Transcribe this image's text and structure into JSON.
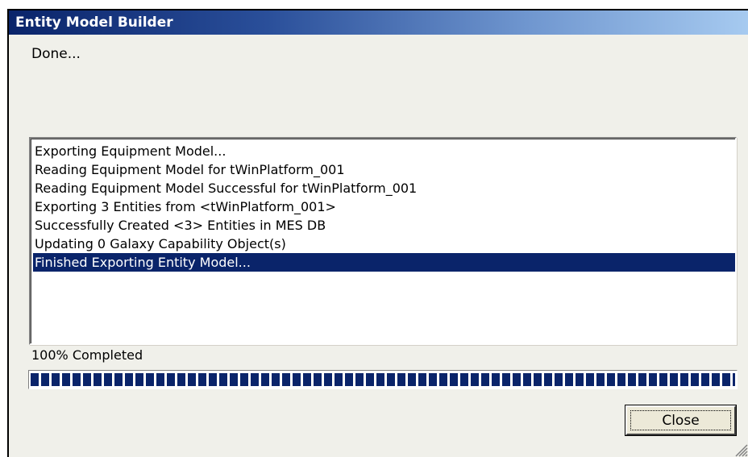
{
  "window": {
    "title": "Entity Model Builder"
  },
  "status": {
    "text": "Done..."
  },
  "log": {
    "items": [
      "Exporting Equipment Model...",
      "Reading Equipment Model for tWinPlatform_001",
      "Reading Equipment Model Successful for tWinPlatform_001",
      "Exporting 3 Entities from <tWinPlatform_001>",
      "Successfully Created <3> Entities in MES DB",
      "Updating 0 Galaxy Capability Object(s)",
      "Finished Exporting Entity Model..."
    ],
    "selected_index": 6
  },
  "progress": {
    "label": "100% Completed",
    "value_percent": 100
  },
  "buttons": {
    "close_label": "Close"
  },
  "colors": {
    "selection": "#0a246a",
    "progress_segment": "#0a246a",
    "title_gradient_start": "#0a246a",
    "title_gradient_end": "#a6caf0"
  }
}
